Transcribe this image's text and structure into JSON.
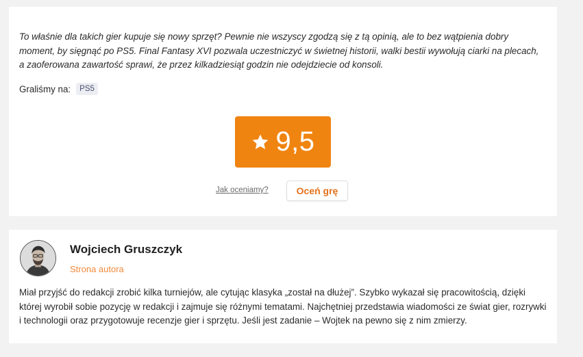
{
  "review": {
    "verdict": "To właśnie dla takich gier kupuje się nowy sprzęt? Pewnie nie wszyscy zgodzą się z tą opinią, ale to bez wątpienia dobry moment, by sięgnąć po PS5. Final Fantasy XVI pozwala uczestniczyć w świetnej historii, walki bestii wywołują ciarki na plecach, a zaoferowana zawartość sprawi, że przez kilkadziesiąt godzin nie odejdziecie od konsoli.",
    "played_on_label": "Graliśmy na:",
    "platform": "PS5",
    "score": "9,5",
    "score_icon": "star-icon",
    "how_we_rate": "Jak oceniamy?",
    "rate_button": "Oceń grę",
    "colors": {
      "score_bg": "#f08411",
      "rate_text": "#e2711a"
    }
  },
  "author": {
    "name": "Wojciech Gruszczyk",
    "page_link": "Strona autora",
    "bio": "Miał przyjść do redakcji zrobić kilka turniejów, ale cytując klasyka „został na dłużej”. Szybko wykazał się pracowitością, dzięki której wyrobił sobie pozycję w redakcji i zajmuje się różnymi tematami. Najchętniej przedstawia wiadomości ze świat gier, rozrywki i technologii oraz przygotowuje recenzje gier i sprzętu. Jeśli jest zadanie – Wojtek na pewno się z nim zmierzy.",
    "link_color": "#f08a3a"
  }
}
